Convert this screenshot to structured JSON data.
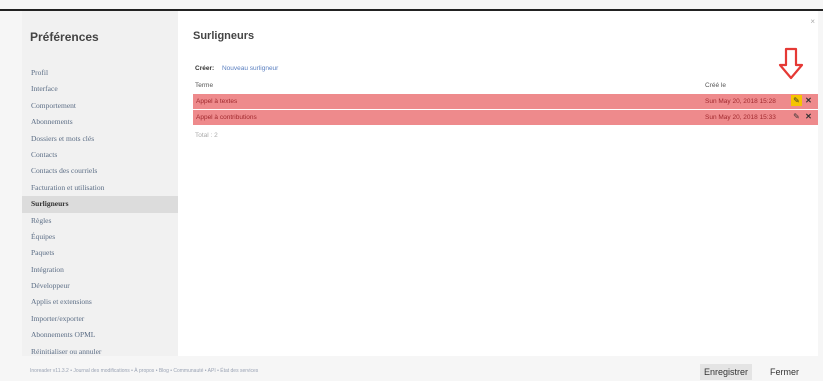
{
  "sidebar": {
    "title": "Préférences",
    "items": [
      {
        "label": "Profil",
        "active": false
      },
      {
        "label": "Interface",
        "active": false
      },
      {
        "label": "Comportement",
        "active": false
      },
      {
        "label": "Abonnements",
        "active": false
      },
      {
        "label": "Dossiers et mots clés",
        "active": false
      },
      {
        "label": "Contacts",
        "active": false
      },
      {
        "label": "Contacts des courriels",
        "active": false
      },
      {
        "label": "Facturation et utilisation",
        "active": false
      },
      {
        "label": "Surligneurs",
        "active": true
      },
      {
        "label": "Règles",
        "active": false
      },
      {
        "label": "Équipes",
        "active": false
      },
      {
        "label": "Paquets",
        "active": false
      },
      {
        "label": "Intégration",
        "active": false
      },
      {
        "label": "Développeur",
        "active": false
      },
      {
        "label": "Applis et extensions",
        "active": false
      },
      {
        "label": "Importer/exporter",
        "active": false
      },
      {
        "label": "Abonnements OPML",
        "active": false
      },
      {
        "label": "Réinitialiser ou annuler",
        "active": false
      }
    ]
  },
  "main": {
    "close_icon": "×",
    "title": "Surligneurs",
    "create_label": "Créer:",
    "create_link": "Nouveau surligneur",
    "columns": {
      "term": "Terme",
      "created": "Créé le"
    },
    "rows": [
      {
        "term": "Appel à textes",
        "created": "Sun May 20, 2018 15:28",
        "edit_highlighted": true
      },
      {
        "term": "Appel à contributions",
        "created": "Sun May 20, 2018 15:33",
        "edit_highlighted": false
      }
    ],
    "total": "Total : 2",
    "row_color": "#ee8a8c",
    "highlight_color": "#f5c400",
    "arrow_color": "#e53935"
  },
  "footer": {
    "links": "Inoreader v11.3.2 • Journal des modifications • À propos • Blog • Communauté • API • État des services",
    "save_label": "Enregistrer",
    "close_label": "Fermer"
  }
}
